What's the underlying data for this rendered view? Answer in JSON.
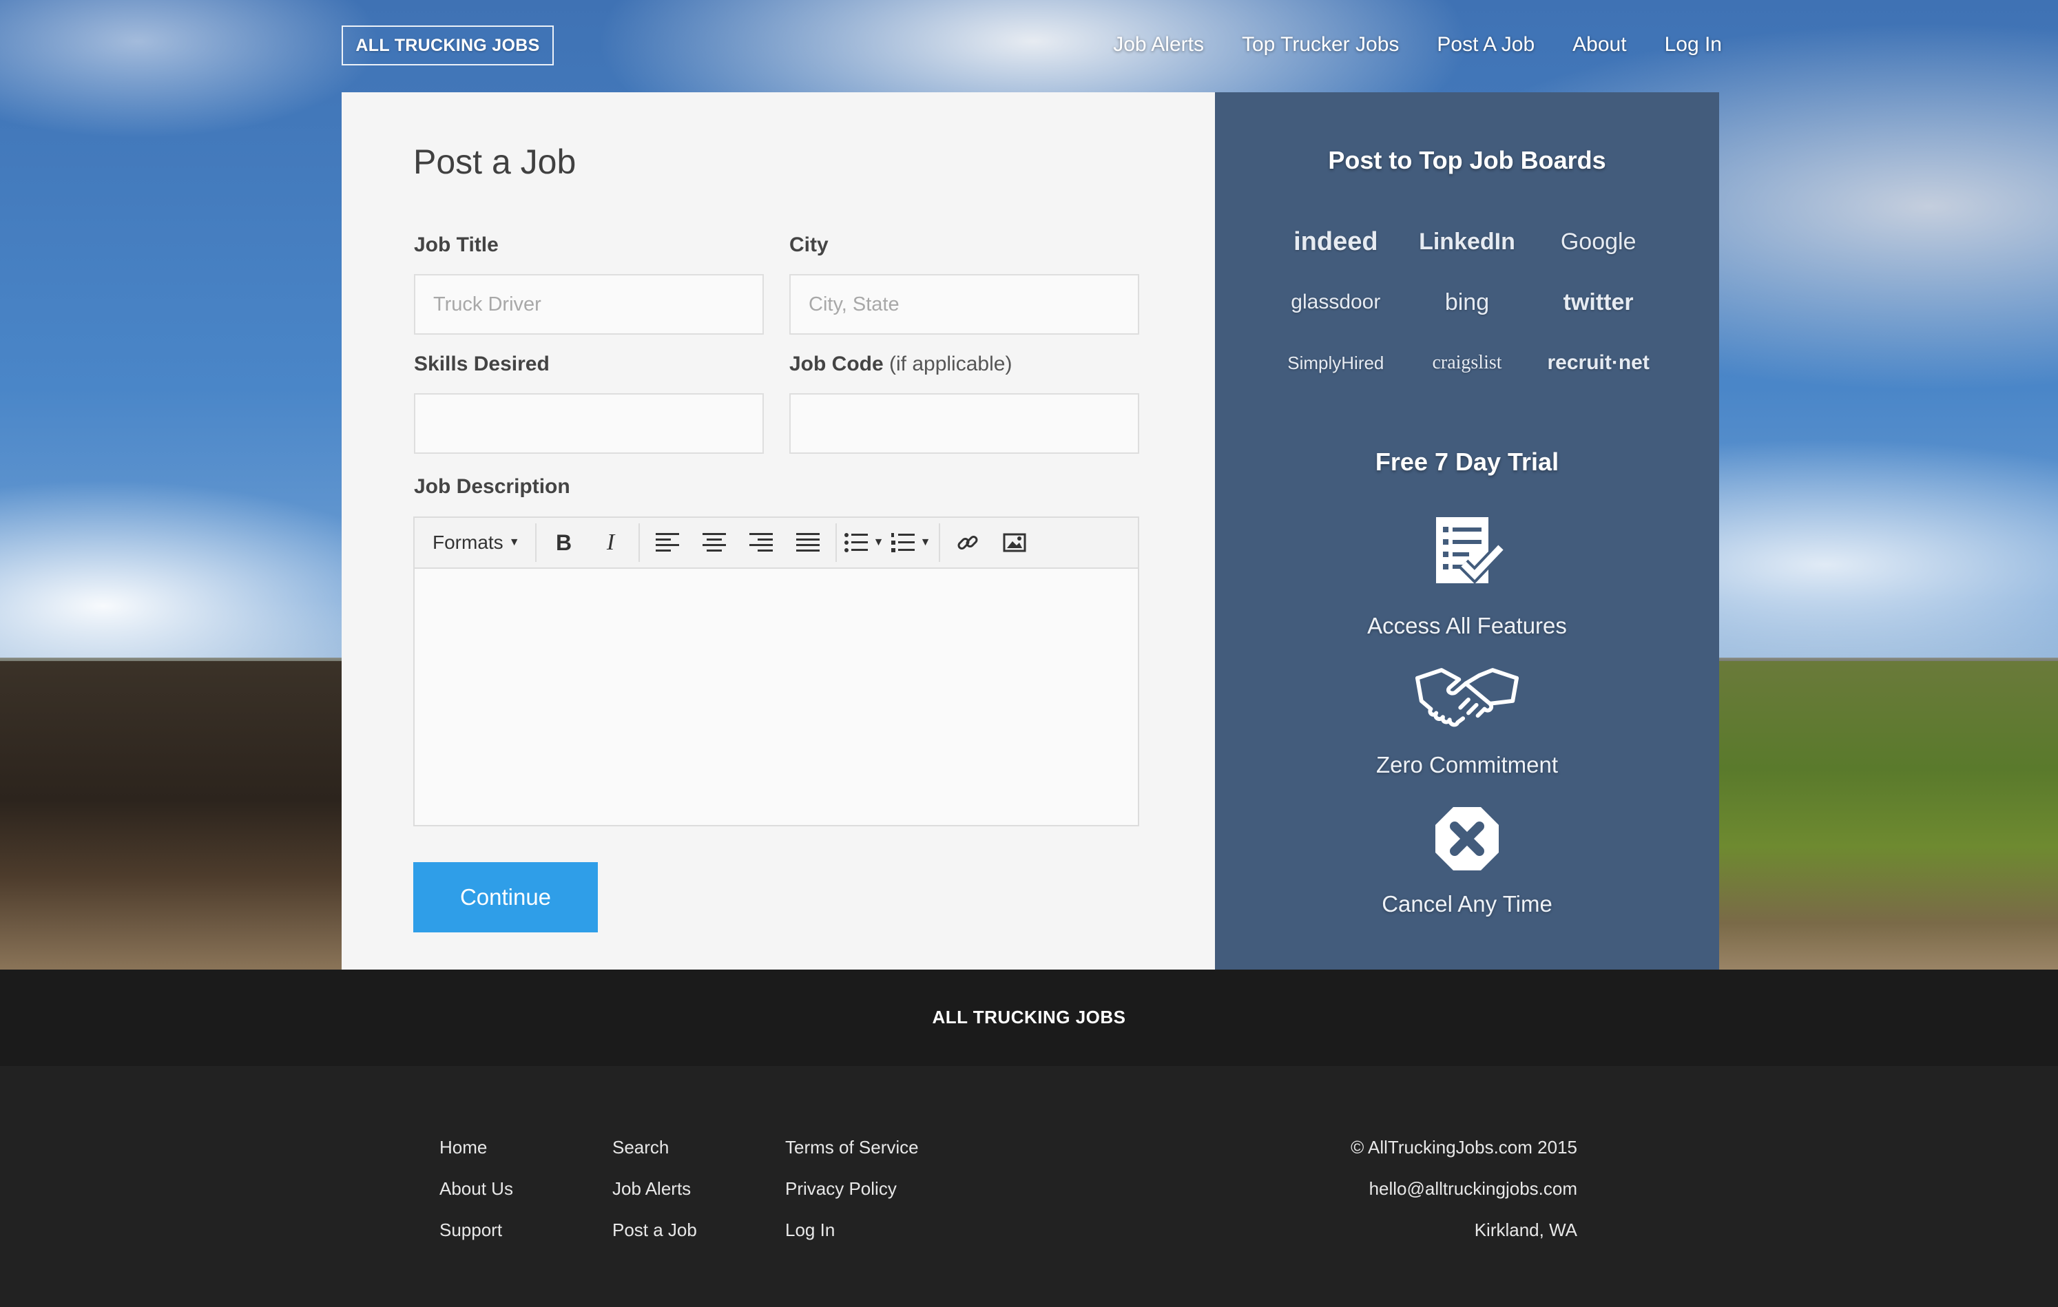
{
  "nav": {
    "logo": "ALL TRUCKING JOBS",
    "links": [
      "Job Alerts",
      "Top Trucker Jobs",
      "Post A Job",
      "About",
      "Log In"
    ]
  },
  "form": {
    "title": "Post a Job",
    "job_title_label": "Job Title",
    "job_title_placeholder": "Truck Driver",
    "city_label": "City",
    "city_placeholder": "City, State",
    "skills_label": "Skills Desired",
    "job_code_label": "Job Code",
    "job_code_note": "(if applicable)",
    "description_label": "Job Description",
    "toolbar": {
      "formats_label": "Formats",
      "bold": "B",
      "italic": "I"
    },
    "continue_label": "Continue"
  },
  "side": {
    "title": "Post to Top Job Boards",
    "boards": [
      "indeed",
      "LinkedIn",
      "Google",
      "glassdoor",
      "bing",
      "twitter",
      "SimplyHired",
      "craigslist",
      "recruit·net"
    ],
    "trial_title": "Free 7 Day Trial",
    "features": [
      "Access All Features",
      "Zero Commitment",
      "Cancel Any Time"
    ]
  },
  "footer": {
    "brand": "ALL TRUCKING JOBS",
    "col1": [
      "Home",
      "About Us",
      "Support"
    ],
    "col2": [
      "Search",
      "Job Alerts",
      "Post a Job"
    ],
    "col3": [
      "Terms of Service",
      "Privacy Policy",
      "Log In"
    ],
    "copyright": "© AllTruckingJobs.com 2015",
    "email": "hello@alltruckingjobs.com",
    "location": "Kirkland, WA"
  }
}
